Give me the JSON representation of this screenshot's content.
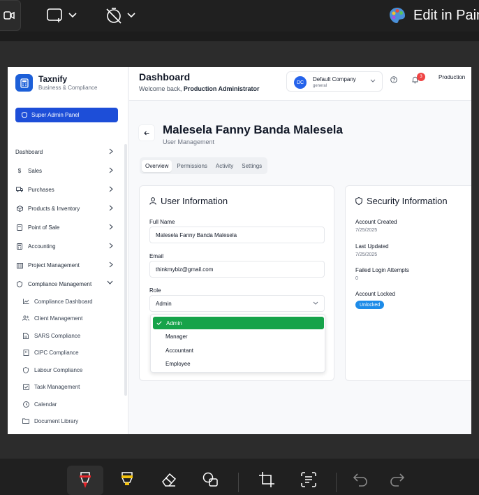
{
  "snip_toolbar": {
    "edit_in_paint_label": "Edit in Paint",
    "bottom_tools": [
      "pen-tool",
      "highlighter-tool",
      "eraser-tool",
      "shapes-tool",
      "crop-tool",
      "text-actions-tool",
      "undo",
      "redo"
    ]
  },
  "app": {
    "brand": {
      "name": "Taxnify",
      "subtitle": "Business & Compliance",
      "accent": "#1d4ed8"
    },
    "admin_panel_label": "Super Admin Panel",
    "sidebar": {
      "items": [
        {
          "label": "Dashboard",
          "icon": "none"
        },
        {
          "label": "Sales",
          "icon": "dollar-icon"
        },
        {
          "label": "Purchases",
          "icon": "truck-icon"
        },
        {
          "label": "Products & Inventory",
          "icon": "box-icon"
        },
        {
          "label": "Point of Sale",
          "icon": "terminal-icon"
        },
        {
          "label": "Accounting",
          "icon": "calculator-icon"
        },
        {
          "label": "Project Management",
          "icon": "building-icon"
        },
        {
          "label": "Compliance Management",
          "icon": "shield-icon"
        }
      ],
      "sub_items": [
        {
          "label": "Compliance Dashboard",
          "icon": "chart-icon"
        },
        {
          "label": "Client Management",
          "icon": "users-icon"
        },
        {
          "label": "SARS Compliance",
          "icon": "file-icon"
        },
        {
          "label": "CIPC Compliance",
          "icon": "building-icon"
        },
        {
          "label": "Labour Compliance",
          "icon": "shield-icon"
        },
        {
          "label": "Task Management",
          "icon": "checkbox-icon"
        },
        {
          "label": "Calendar",
          "icon": "clock-icon"
        },
        {
          "label": "Document Library",
          "icon": "folder-icon"
        }
      ]
    },
    "header": {
      "title": "Dashboard",
      "welcome_prefix": "Welcome back, ",
      "welcome_name": "Production Administrator",
      "company_initials": "DC",
      "company_name": "Default Company",
      "company_sub": "general",
      "notification_count": "3",
      "user_label": "Production"
    },
    "page": {
      "user_name": "Malesela Fanny Banda Malesela",
      "subtitle": "User Management",
      "tabs": [
        "Overview",
        "Permissions",
        "Activity",
        "Settings"
      ],
      "active_tab": "Overview"
    },
    "user_info": {
      "title": "User Information",
      "full_name_label": "Full Name",
      "full_name_value": "Malesela Fanny Banda Malesela",
      "email_label": "Email",
      "email_value": "thinkmybiz@gmail.com",
      "role_label": "Role",
      "role_value": "Admin",
      "role_options": [
        "Admin",
        "Manager",
        "Accountant",
        "Employee"
      ],
      "selected_color": "#16a34a"
    },
    "security_info": {
      "title": "Security Information",
      "account_created_label": "Account Created",
      "account_created_value": "7/25/2025",
      "last_updated_label": "Last Updated",
      "last_updated_value": "7/25/2025",
      "failed_login_label": "Failed Login Attempts",
      "failed_login_value": "0",
      "account_locked_label": "Account Locked",
      "account_locked_value": "Unlocked"
    }
  }
}
